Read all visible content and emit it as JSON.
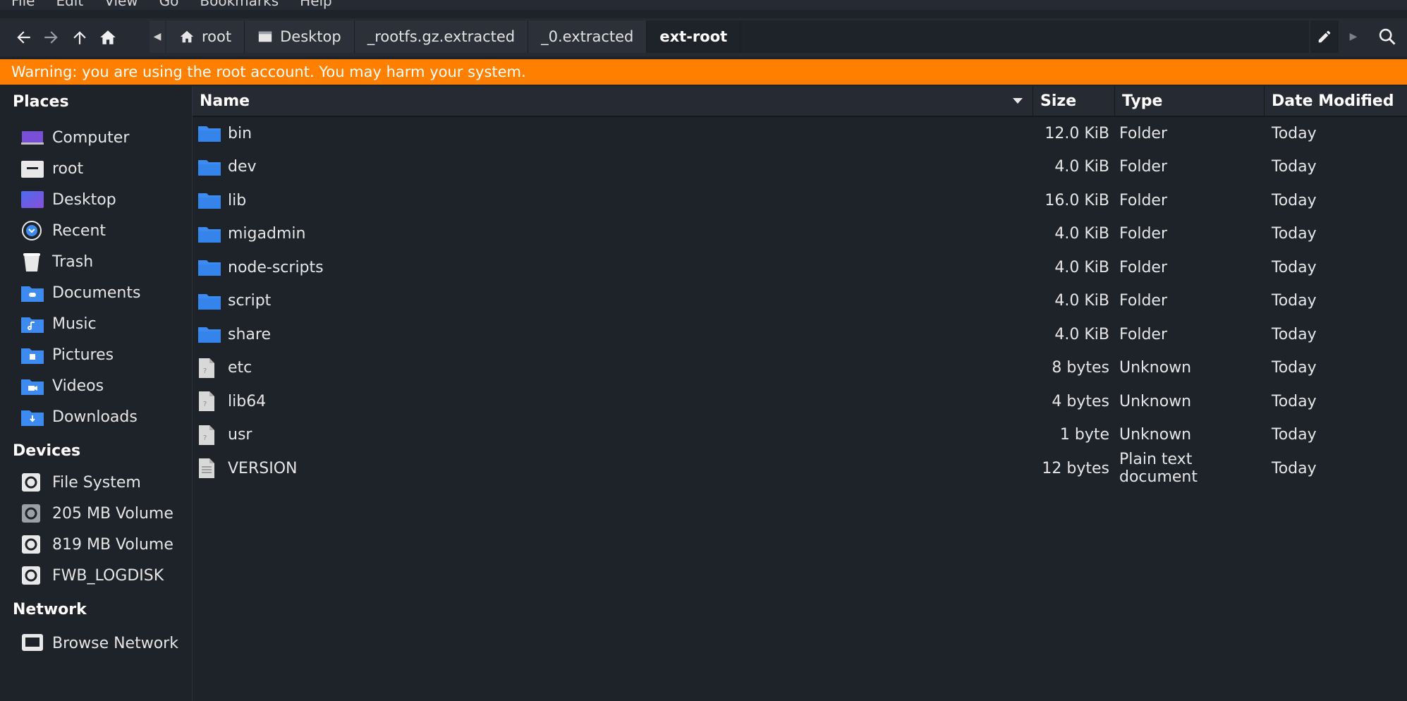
{
  "menu": [
    "File",
    "Edit",
    "View",
    "Go",
    "Bookmarks",
    "Help"
  ],
  "toolbar": {
    "back_icon": "arrow-left-icon",
    "forward_icon": "arrow-right-icon",
    "up_icon": "arrow-up-icon",
    "home_icon": "home-icon"
  },
  "pathbar": {
    "crumbs": [
      {
        "label": "root",
        "icon": "home-icon"
      },
      {
        "label": "Desktop",
        "icon": "desktop-icon"
      },
      {
        "label": "_rootfs.gz.extracted",
        "icon": ""
      },
      {
        "label": "_0.extracted",
        "icon": ""
      },
      {
        "label": "ext-root",
        "icon": ""
      }
    ]
  },
  "warning": "Warning: you are using the root account. You may harm your system.",
  "sidebar": {
    "places_heading": "Places",
    "places": [
      {
        "label": "Computer",
        "icon": "computer-icon"
      },
      {
        "label": "root",
        "icon": "home-folder-icon"
      },
      {
        "label": "Desktop",
        "icon": "desktop-icon"
      },
      {
        "label": "Recent",
        "icon": "recent-icon"
      },
      {
        "label": "Trash",
        "icon": "trash-icon"
      },
      {
        "label": "Documents",
        "icon": "documents-folder-icon"
      },
      {
        "label": "Music",
        "icon": "music-folder-icon"
      },
      {
        "label": "Pictures",
        "icon": "pictures-folder-icon"
      },
      {
        "label": "Videos",
        "icon": "videos-folder-icon"
      },
      {
        "label": "Downloads",
        "icon": "downloads-folder-icon"
      }
    ],
    "devices_heading": "Devices",
    "devices": [
      {
        "label": "File System",
        "icon": "drive-icon"
      },
      {
        "label": "205 MB Volume",
        "icon": "drive-icon"
      },
      {
        "label": "819 MB Volume",
        "icon": "drive-icon"
      },
      {
        "label": "FWB_LOGDISK",
        "icon": "drive-icon"
      }
    ],
    "network_heading": "Network",
    "network": [
      {
        "label": "Browse Network",
        "icon": "network-icon"
      }
    ]
  },
  "columns": {
    "name": "Name",
    "size": "Size",
    "type": "Type",
    "date": "Date Modified"
  },
  "files": [
    {
      "name": "bin",
      "size": "12.0 KiB",
      "type": "Folder",
      "date": "Today",
      "icon": "folder-icon"
    },
    {
      "name": "dev",
      "size": "4.0 KiB",
      "type": "Folder",
      "date": "Today",
      "icon": "folder-icon"
    },
    {
      "name": "lib",
      "size": "16.0 KiB",
      "type": "Folder",
      "date": "Today",
      "icon": "folder-icon"
    },
    {
      "name": "migadmin",
      "size": "4.0 KiB",
      "type": "Folder",
      "date": "Today",
      "icon": "folder-icon"
    },
    {
      "name": "node-scripts",
      "size": "4.0 KiB",
      "type": "Folder",
      "date": "Today",
      "icon": "folder-icon"
    },
    {
      "name": "script",
      "size": "4.0 KiB",
      "type": "Folder",
      "date": "Today",
      "icon": "folder-icon"
    },
    {
      "name": "share",
      "size": "4.0 KiB",
      "type": "Folder",
      "date": "Today",
      "icon": "folder-icon"
    },
    {
      "name": "etc",
      "size": "8 bytes",
      "type": "Unknown",
      "date": "Today",
      "icon": "unknown-file-icon"
    },
    {
      "name": "lib64",
      "size": "4 bytes",
      "type": "Unknown",
      "date": "Today",
      "icon": "unknown-file-icon"
    },
    {
      "name": "usr",
      "size": "1 byte",
      "type": "Unknown",
      "date": "Today",
      "icon": "unknown-file-icon"
    },
    {
      "name": "VERSION",
      "size": "12 bytes",
      "type": "Plain text document",
      "date": "Today",
      "icon": "text-file-icon"
    }
  ],
  "colors": {
    "warning": "#ff7f00",
    "folder": "#3d8bf0",
    "background": "#1e2229"
  }
}
